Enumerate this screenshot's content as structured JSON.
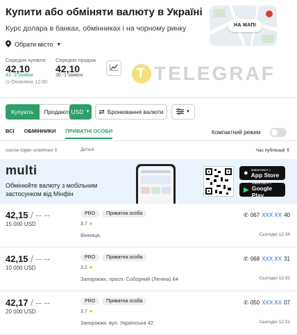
{
  "header": {
    "title": "Купити або обміняти валюту в Україні",
    "subtitle": "Курс долара в банках, обмінниках і на чорному ринку",
    "map_button": "НА МАПІ",
    "city_select": "Обрати місто"
  },
  "stats": {
    "buy": {
      "label": "Середня купівля",
      "value": "42,10",
      "requests": "43 -3 заявки",
      "updated": "Оновлено 12:00"
    },
    "sell": {
      "label": "Середня продаж",
      "value": "42,10",
      "requests": "30 -1 заявок"
    }
  },
  "watermark": "TELEGRAF",
  "controls": {
    "buy_label": "Купують",
    "sell_label": "Продають",
    "currency": "USD",
    "booking_label": "Бронювання валюти"
  },
  "tabs": [
    {
      "label": "ВСІ"
    },
    {
      "label": "ОБМІННИКИ"
    },
    {
      "label": "ПРИВАТНІ ОСОБИ"
    }
  ],
  "compact_label": "Компактний режим",
  "columns": {
    "course": "course togler undefined",
    "details": "Деталі",
    "time": "Час публікації"
  },
  "banner": {
    "logo": "multi",
    "text": "Обмінюйте валюту з мобільним застосунком від Мінфін",
    "appstore_small": "Завантажте з",
    "appstore_big": "App Store",
    "googleplay_small": "Завантажте з",
    "googleplay_big": "Google Play"
  },
  "listings": [
    {
      "rate": "42,15",
      "rate_tail": "/ -- --",
      "amount": "15 000 USD",
      "badge_pro": "PRO",
      "badge_type": "Приватна особа",
      "rating": "3.7",
      "address": "Вінниця,",
      "phone_prefix": "067",
      "phone_hidden": "XXX XX",
      "phone_suffix": "40",
      "time": "Сьогодні 12:34"
    },
    {
      "rate": "42,15",
      "rate_tail": "/ -- --",
      "amount": "10 000 USD",
      "badge_pro": "PRO",
      "badge_type": "Приватна особа",
      "rating": "3.2",
      "address": "Запоріжжя, просп. Соборний (Леніна) 64",
      "phone_prefix": "068",
      "phone_hidden": "XXX XX",
      "phone_suffix": "31",
      "time": "Сьогодні 12:33"
    },
    {
      "rate": "42,17",
      "rate_tail": "/ -- --",
      "amount": "20 000 USD",
      "badge_pro": "PRO",
      "badge_type": "Приватна особа",
      "rating": "3.7",
      "address": "Запоріжжя, вул. Українська 42",
      "phone_prefix": "050",
      "phone_hidden": "XXX XX",
      "phone_suffix": "07",
      "time": "Сьогодні 12:31"
    }
  ],
  "colors": {
    "accent": "#2e9e6a",
    "accent_red": "#c0392b",
    "link": "#2a6ac8"
  }
}
